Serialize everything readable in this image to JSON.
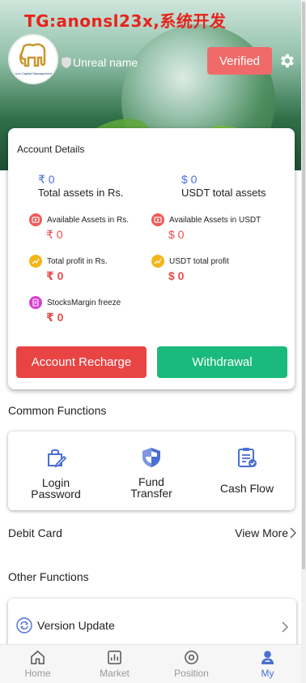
{
  "watermark": "TG:anonsl23x,系统开发",
  "header": {
    "username": "Unreal name",
    "verified_label": "Verified",
    "avatar_text": "Lion Capital Management"
  },
  "account": {
    "title": "Account Details",
    "total_assets_value": "₹  0",
    "total_assets_label": "Total assets in Rs.",
    "usdt_assets_value": "$  0",
    "usdt_assets_label": "USDT total assets",
    "available_rs_label": "Available Assets in Rs.",
    "available_rs_value": "₹ 0",
    "available_usdt_label": "Available Assets in USDT",
    "available_usdt_value": "$ 0",
    "profit_rs_label": "Total profit in Rs.",
    "profit_rs_value": "₹ 0",
    "profit_usdt_label": "USDT total profit",
    "profit_usdt_value": "$ 0",
    "margin_label": "StocksMargin freeze",
    "margin_value": "₹ 0",
    "recharge_label": "Account Recharge",
    "withdraw_label": "Withdrawal"
  },
  "common": {
    "title": "Common Functions",
    "items": [
      {
        "line1": "Login",
        "line2": "Password"
      },
      {
        "line1": "Fund",
        "line2": "Transfer"
      },
      {
        "line1": "Cash Flow",
        "line2": ""
      }
    ]
  },
  "debit": {
    "label": "Debit Card",
    "view_more": "View More"
  },
  "other": {
    "title": "Other Functions",
    "version_label": "Version Update"
  },
  "tabs": [
    {
      "label": "Home"
    },
    {
      "label": "Market"
    },
    {
      "label": "Position"
    },
    {
      "label": "My"
    }
  ],
  "colors": {
    "accent_blue": "#4a6fd3",
    "red": "#e84444",
    "green": "#1aba7c",
    "verified": "#f06a6a"
  }
}
